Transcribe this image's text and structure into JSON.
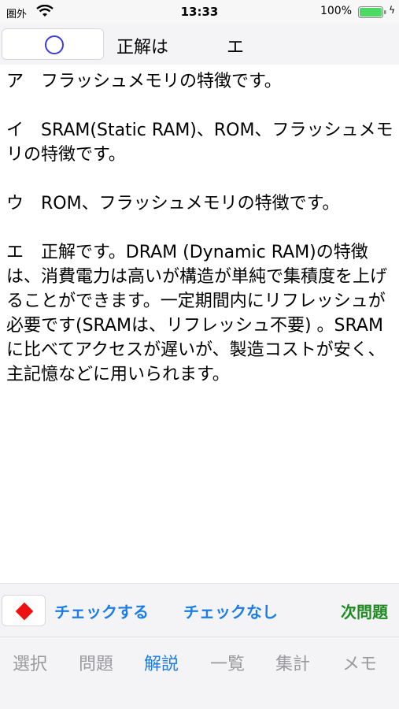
{
  "status_bar": {
    "carrier": "圏外",
    "time": "13:33",
    "battery_percent": "100%",
    "battery_level": 1.0,
    "battery_color": "#4cd964"
  },
  "header": {
    "mark_icon": "circle-icon",
    "mark_color": "#3a3ae0",
    "answer_label": "正解は",
    "answer_value": "エ"
  },
  "explanation": {
    "paragraphs": [
      "ア　フラッシュメモリの特徴です。",
      "イ　SRAM(Static RAM)、ROM、フラッシュメモリの特徴です。",
      "ウ　ROM、フラッシュメモリの特徴です。",
      "エ　正解です。DRAM (Dynamic RAM)の特徴は、消費電力は高いが構造が単純で集積度を上げることができます。一定期間内にリフレッシュが必要です(SRAMは、リフレッシュ不要) 。SRAMに比べてアクセスが遅いが、製造コストが安く、主記憶などに用いられます。"
    ]
  },
  "action_bar": {
    "flag_icon": "diamond-icon",
    "flag_color": "#ee1111",
    "check_label": "チェックする",
    "uncheck_label": "チェックなし",
    "next_label": "次問題"
  },
  "tabs": [
    {
      "label": "選択",
      "active": false
    },
    {
      "label": "問題",
      "active": false
    },
    {
      "label": "解説",
      "active": true
    },
    {
      "label": "一覧",
      "active": false
    },
    {
      "label": "集計",
      "active": false
    },
    {
      "label": "メモ",
      "active": false
    }
  ]
}
